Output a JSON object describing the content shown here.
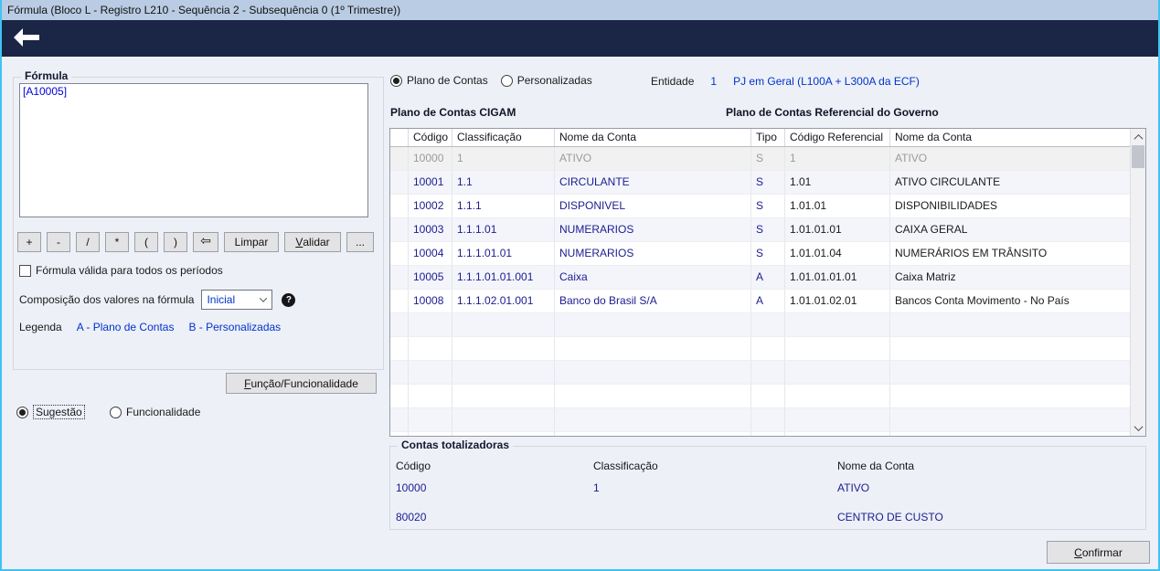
{
  "window": {
    "title": "Fórmula (Bloco L - Registro L210 - Sequência 2 - Subsequência 0 (1º Trimestre))"
  },
  "icons": {
    "back": "←",
    "backspace": "⇦",
    "help": "?"
  },
  "formula_panel": {
    "group_label": "Fórmula",
    "formula_text": "[A10005]",
    "operator_buttons": [
      "+",
      "-",
      "/",
      "*",
      "(",
      ")"
    ],
    "clear_label": "Limpar",
    "validate_label": "Validar",
    "more_label": "...",
    "checkbox_label": "Fórmula válida para todos os períodos",
    "checkbox_checked": false,
    "composition_label": "Composição dos valores na fórmula",
    "composition_value": "Inicial",
    "legend_label": "Legenda",
    "legend_a": "A - Plano de Contas",
    "legend_b": "B - Personalizadas",
    "function_button": "Função/Funcionalidade",
    "radio_suggestion": "Sugestão",
    "radio_functionality": "Funcionalidade",
    "selected_radio": "Sugestão"
  },
  "accounts_panel": {
    "radio_plan": "Plano de Contas",
    "radio_custom": "Personalizadas",
    "selected_radio": "Plano de Contas",
    "entity_label": "Entidade",
    "entity_code": "1",
    "entity_name": "PJ em Geral (L100A + L300A da ECF)",
    "left_title": "Plano de Contas CIGAM",
    "right_title": "Plano de Contas Referencial do Governo",
    "table": {
      "headers": [
        "",
        "Código",
        "Classificação",
        "Nome da Conta",
        "Tipo",
        "Código Referencial",
        "Nome da Conta"
      ],
      "rows": [
        {
          "codigo": "10000",
          "classificacao": "1",
          "nome": "ATIVO",
          "tipo": "S",
          "cod_ref": "1",
          "nome_ref": "ATIVO",
          "disabled": true
        },
        {
          "codigo": "10001",
          "classificacao": "1.1",
          "nome": "CIRCULANTE",
          "tipo": "S",
          "cod_ref": "1.01",
          "nome_ref": "ATIVO CIRCULANTE"
        },
        {
          "codigo": "10002",
          "classificacao": "1.1.1",
          "nome": "DISPONIVEL",
          "tipo": "S",
          "cod_ref": "1.01.01",
          "nome_ref": "DISPONIBILIDADES"
        },
        {
          "codigo": "10003",
          "classificacao": "1.1.1.01",
          "nome": "NUMERARIOS",
          "tipo": "S",
          "cod_ref": "1.01.01.01",
          "nome_ref": "CAIXA GERAL"
        },
        {
          "codigo": "10004",
          "classificacao": "1.1.1.01.01",
          "nome": "NUMERARIOS",
          "tipo": "S",
          "cod_ref": "1.01.01.04",
          "nome_ref": "NUMERÁRIOS EM TRÂNSITO"
        },
        {
          "codigo": "10005",
          "classificacao": "1.1.1.01.01.001",
          "nome": "Caixa",
          "tipo": "A",
          "cod_ref": "1.01.01.01.01",
          "nome_ref": "Caixa Matriz"
        },
        {
          "codigo": "10008",
          "classificacao": "1.1.1.02.01.001",
          "nome": "Banco do Brasil S/A",
          "tipo": "A",
          "cod_ref": "1.01.01.02.01",
          "nome_ref": "Bancos Conta Movimento - No País"
        }
      ],
      "empty_row_count": 6
    }
  },
  "totals_panel": {
    "group_label": "Contas totalizadoras",
    "headers": [
      "Código",
      "Classificação",
      "Nome da Conta"
    ],
    "rows": [
      {
        "codigo": "10000",
        "classificacao": "1",
        "nome": "ATIVO"
      },
      {
        "codigo": "80020",
        "classificacao": "",
        "nome": "CENTRO DE CUSTO"
      }
    ]
  },
  "footer": {
    "confirm_label": "Confirmar"
  },
  "colors": {
    "navy": "#1b2545",
    "titlebar": "#b9cce4",
    "window_bg": "#edf0f7",
    "border_blue": "#41c3f2",
    "data_navy": "#1c1c8f",
    "link_blue": "#0033cc",
    "formula_blue": "#0000dd",
    "disabled_gray": "#9b9b9b",
    "row_tint": "#f3f5fb"
  }
}
